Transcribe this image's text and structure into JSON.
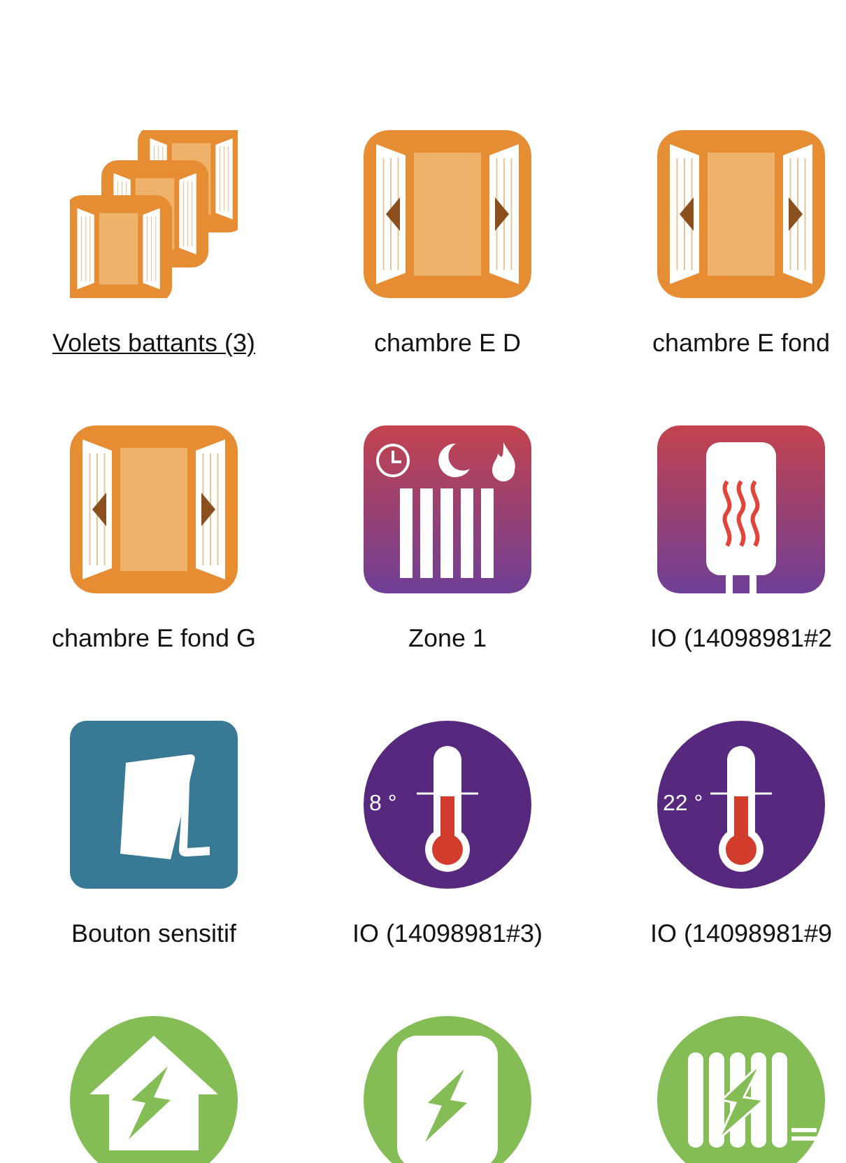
{
  "rows": [
    {
      "devices": [
        {
          "kind": "shutter-group",
          "label": "Volets battants (3)",
          "link": true
        },
        {
          "kind": "shutter",
          "label": "chambre E D"
        },
        {
          "kind": "shutter",
          "label": "chambre E fond"
        }
      ]
    },
    {
      "devices": [
        {
          "kind": "shutter",
          "label": "chambre E fond G"
        },
        {
          "kind": "heating-zone",
          "label": "Zone 1"
        },
        {
          "kind": "water-heater",
          "label": "IO (14098981#2"
        }
      ]
    },
    {
      "devices": [
        {
          "kind": "touch-button",
          "label": "Bouton sensitif"
        },
        {
          "kind": "thermometer",
          "label": "IO (14098981#3)",
          "reading": "8 °"
        },
        {
          "kind": "thermometer",
          "label": "IO (14098981#9",
          "reading": "22 °"
        }
      ]
    },
    {
      "devices": [
        {
          "kind": "energy-house"
        },
        {
          "kind": "energy-heater"
        },
        {
          "kind": "energy-radiator"
        }
      ]
    }
  ]
}
